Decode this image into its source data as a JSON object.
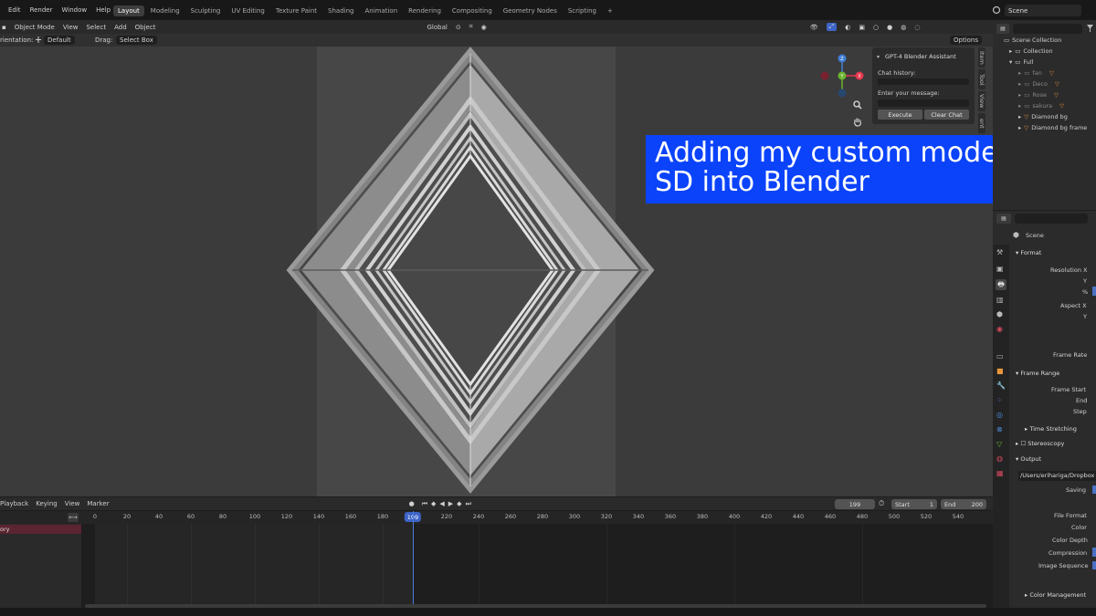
{
  "topbar": {
    "menu": [
      "Edit",
      "Render",
      "Window",
      "Help"
    ],
    "workspaces": [
      "Layout",
      "Modeling",
      "Sculpting",
      "UV Editing",
      "Texture Paint",
      "Shading",
      "Animation",
      "Rendering",
      "Compositing",
      "Geometry Nodes",
      "Scripting",
      "+"
    ],
    "active_workspace": "Layout",
    "scene_name": "Scene"
  },
  "viewport_header": {
    "mode": "Object Mode",
    "menus": [
      "View",
      "Select",
      "Add",
      "Object"
    ],
    "transform": "Global",
    "options": "Options"
  },
  "tool_header": {
    "orientation_label": "rientation:",
    "orientation_value": "Default",
    "drag_label": "Drag:",
    "drag_value": "Select Box"
  },
  "assistant": {
    "title": "GPT-4 Blender Assistant",
    "history_label": "Chat history:",
    "message_label": "Enter your message:",
    "execute": "Execute",
    "clear": "Clear Chat"
  },
  "side_tabs": [
    "Item",
    "Tool",
    "View",
    "ent"
  ],
  "caption": {
    "line1": "Adding my custom model from",
    "line2": "SD into Blender"
  },
  "outliner": {
    "root": "Scene Collection",
    "rows": [
      "Collection",
      "Full",
      "fan",
      "Deco",
      "Rose",
      "sakura",
      "Diamond bg",
      "Diamond bg frame"
    ]
  },
  "properties": {
    "scene": "Scene",
    "format": "Format",
    "resolution_x": "Resolution X",
    "y": "Y",
    "percent": "%",
    "aspect_x": "Aspect X",
    "aspect_y": "Y",
    "frame_rate": "Frame Rate",
    "frame_range": "Frame Range",
    "frame_start": "Frame Start",
    "end": "End",
    "step": "Step",
    "time_stretching": "Time Stretching",
    "stereoscopy": "Stereoscopy",
    "output": "Output",
    "output_path": "/Users/erihariga/Dropbox",
    "saving": "Saving",
    "file_format": "File Format",
    "color": "Color",
    "color_depth": "Color Depth",
    "compression": "Compression",
    "image_sequence": "Image Sequence",
    "color_management": "Color Management"
  },
  "timeline": {
    "menus": [
      "Playback",
      "Keying",
      "View",
      "Marker"
    ],
    "current_frame": "199",
    "start_label": "Start",
    "start_value": "1",
    "end_label": "End",
    "end_value": "200",
    "ticks": [
      "0",
      "20",
      "40",
      "60",
      "80",
      "100",
      "120",
      "140",
      "160",
      "180",
      "199",
      "220",
      "240",
      "260",
      "280",
      "300",
      "320",
      "340",
      "360",
      "380",
      "400",
      "420",
      "440",
      "460",
      "480",
      "500",
      "520",
      "540"
    ],
    "side_label": "ory"
  },
  "colors": {
    "caption_bg": "#0b43fb",
    "playhead": "#3d63c6",
    "axis_x": "#e5384e",
    "axis_y": "#6bb52f",
    "axis_z": "#3f7ed6"
  }
}
